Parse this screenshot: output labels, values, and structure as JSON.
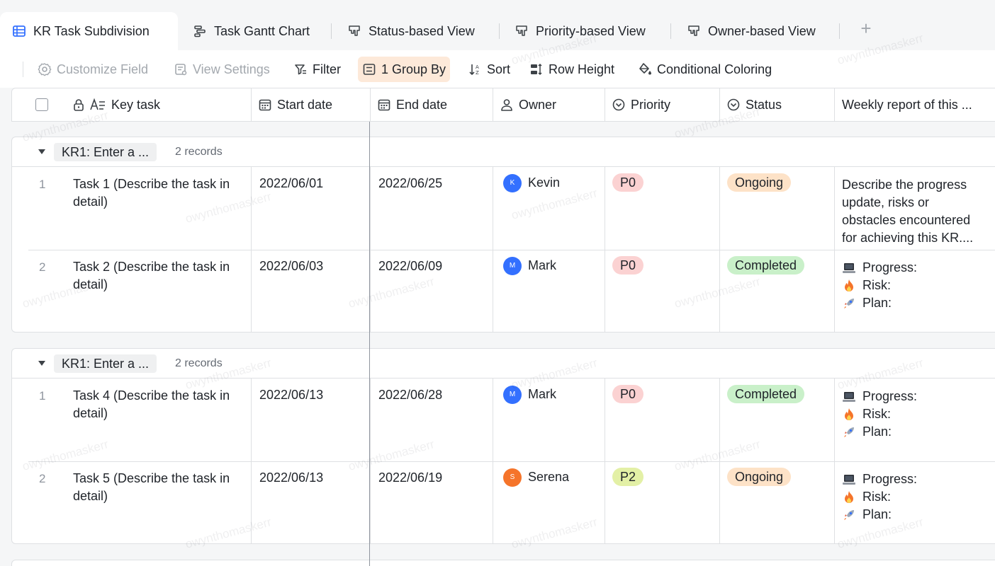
{
  "tabs": [
    {
      "label": "KR Task Subdivision",
      "icon": "grid-table-icon",
      "active": true
    },
    {
      "label": "Task Gantt Chart",
      "icon": "gantt-icon",
      "active": false
    },
    {
      "label": "Status-based View",
      "icon": "kanban-icon",
      "active": false
    },
    {
      "label": "Priority-based View",
      "icon": "kanban-icon",
      "active": false
    },
    {
      "label": "Owner-based View",
      "icon": "kanban-icon",
      "active": false
    }
  ],
  "add_tab_label": "+",
  "toolbar": {
    "customize_field": "Customize Field",
    "view_settings": "View Settings",
    "filter": "Filter",
    "group_by": "1 Group By",
    "sort": "Sort",
    "row_height": "Row Height",
    "conditional_coloring": "Conditional Coloring"
  },
  "columns": {
    "key_task": "Key task",
    "start_date": "Start date",
    "end_date": "End date",
    "owner": "Owner",
    "priority": "Priority",
    "status": "Status",
    "weekly_report": "Weekly report of this ..."
  },
  "colors": {
    "accent": "#3370ff",
    "p0_bg": "#fbd2d2",
    "p2_bg": "#e3f0a6",
    "ongoing_bg": "#fde2c7",
    "completed_bg": "#c9f0c9",
    "avatar_blue": "#3370ff",
    "avatar_orange": "#f5742a"
  },
  "groups": [
    {
      "label": "KR1: Enter a ...",
      "count": "2 records",
      "rows": [
        {
          "num": "1",
          "task": "Task 1 (Describe the task in detail)",
          "start": "2022/06/01",
          "end": "2022/06/25",
          "owner": "Kevin",
          "owner_initial": "K",
          "priority": "P0",
          "status": "Ongoing",
          "report": [
            "Describe the progress",
            "update, risks or",
            "obstacles encountered",
            "for achieving this KR...."
          ]
        },
        {
          "num": "2",
          "task": "Task 2 (Describe the task in detail)",
          "start": "2022/06/03",
          "end": "2022/06/09",
          "owner": "Mark",
          "owner_initial": "M",
          "priority": "P0",
          "status": "Completed",
          "report": [
            "Progress:",
            "Risk:",
            "Plan:"
          ]
        }
      ]
    },
    {
      "label": "KR1: Enter a ...",
      "count": "2 records",
      "rows": [
        {
          "num": "1",
          "task": "Task 4 (Describe the task in detail)",
          "start": "2022/06/13",
          "end": "2022/06/28",
          "owner": "Mark",
          "owner_initial": "M",
          "priority": "P0",
          "status": "Completed",
          "report": [
            "Progress:",
            "Risk:",
            "Plan:"
          ]
        },
        {
          "num": "2",
          "task": "Task 5 (Describe the task in detail)",
          "start": "2022/06/13",
          "end": "2022/06/19",
          "owner": "Serena",
          "owner_initial": "S",
          "priority": "P2",
          "status": "Ongoing",
          "report": [
            "Progress:",
            "Risk:",
            "Plan:"
          ]
        }
      ]
    }
  ],
  "watermark_text": "owynthomaskerr"
}
